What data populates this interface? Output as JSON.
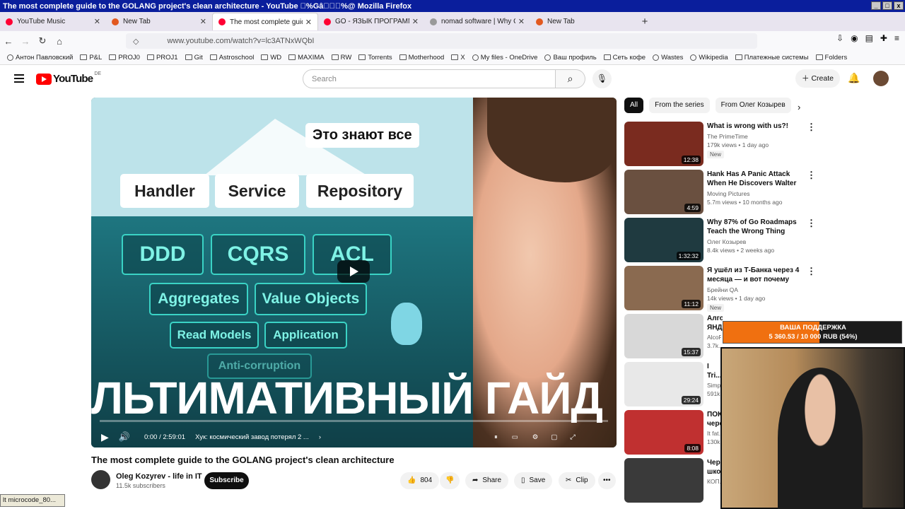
{
  "window": {
    "title": "The most complete guide to the GOLANG project's clean architecture - YouTube \u0000%Gâ\u0000\u0000\u0000%@ Mozilla Firefox"
  },
  "tabs": [
    {
      "label": "YouTube Music",
      "color": "#ff0033"
    },
    {
      "label": "New Tab",
      "color": "#e25920"
    },
    {
      "label": "The most complete guide t",
      "color": "#ff0033",
      "active": true
    },
    {
      "label": "GO - ЯЗЫК ПРОГРАММИР",
      "color": "#ff0033"
    },
    {
      "label": "nomad software | Why Go",
      "color": "#999999"
    },
    {
      "label": "New Tab",
      "color": "#e25920"
    }
  ],
  "nav": {
    "url": "www.youtube.com/watch?v=lc3ATNxWQbI",
    "new_tab": "+"
  },
  "bookmarks": [
    "Антон Павловский",
    "P&L",
    "PROJ0",
    "PROJ1",
    "Git",
    "Astroschool",
    "WD",
    "MAXIMA",
    "RW",
    "Torrents",
    "Motherhood",
    "X",
    "My files - OneDrive",
    "Ваш профиль",
    "Сеть кофе",
    "Wastes",
    "Wikipedia",
    "Платежные системы",
    "Folders"
  ],
  "yt": {
    "logo": "YouTube",
    "country": "DE",
    "search_placeholder": "Search",
    "create": "Create"
  },
  "video": {
    "bubble": "Это знают все",
    "top_labels": [
      "Handler",
      "Service",
      "Repository"
    ],
    "tiles": [
      "DDD",
      "CQRS",
      "ACL",
      "Aggregates",
      "Value Objects",
      "Read Models",
      "Application",
      "Anti-corruption"
    ],
    "big_text": "ЛЬТИМАТИВНЫЙ ГАЙД",
    "time": "0:00 / 2:59:01",
    "chapter": "Хук: космический завод потерял 2 ...",
    "progress": 0.0
  },
  "details": {
    "title": "The most complete guide to the GOLANG project's clean architecture",
    "channel": "Oleg Kozyrev - life in IT",
    "subscribers": "11.5k subscribers",
    "subscribe": "Subscribe",
    "likes": "804",
    "share": "Share",
    "save": "Save",
    "clip": "Clip"
  },
  "chips": [
    "All",
    "From the series",
    "From Олег Козырев"
  ],
  "recs": [
    {
      "title": "What is wrong with us?!",
      "channel": "The PrimeTime",
      "meta": "179k views • 1 day ago",
      "duration": "12:38",
      "new": "New",
      "thumb": "#7a2b1f"
    },
    {
      "title": "Hank Has A Panic Attack When He Discovers Walter is ...",
      "channel": "Moving Pictures",
      "meta": "5.7m views • 10 months ago",
      "duration": "4:59",
      "thumb": "#6a5040"
    },
    {
      "title": "Why 87% of Go Roadmaps Teach the Wrong Thing",
      "channel": "Олег Козырев",
      "meta": "8.4k views • 2 weeks ago",
      "duration": "1:32:32",
      "thumb": "#1f3a40"
    },
    {
      "title": "Я ушёл из Т-Банка через 4 месяца — и вот почему",
      "channel": "Брейни QA",
      "meta": "14k views • 1 day ago",
      "duration": "11:12",
      "new": "New",
      "thumb": "#8a6a50"
    },
    {
      "title": "Алгор... ЯНДЕ...",
      "channel": "AlcoR...",
      "meta": "3.7k...",
      "duration": "15:37",
      "thumb": "#d8d8d8"
    },
    {
      "title": "I Tri... Proc...",
      "channel": "Simp...",
      "meta": "591k...",
      "duration": "29:24",
      "thumb": "#e8e8e8"
    },
    {
      "title": "ПОК... чере...",
      "channel": "It fat...",
      "meta": "130k...",
      "duration": "8:08",
      "thumb": "#c03030"
    },
    {
      "title": "Чер... шко...",
      "channel": "КОП...",
      "meta": "",
      "duration": "",
      "thumb": "#3a3a3a"
    }
  ],
  "donation": {
    "title": "ВАША ПОДДЕРЖКА",
    "amount": "5 360.53 / 10 000 RUB (54%)",
    "fraction": 0.54,
    "color": "#f07010"
  },
  "statusbar": "lt microcode_80..."
}
